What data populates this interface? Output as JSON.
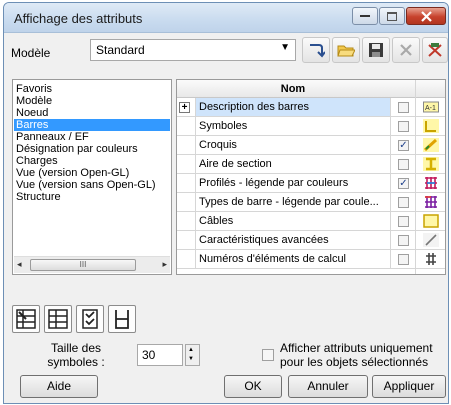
{
  "window": {
    "title": "Affichage des attributs"
  },
  "model": {
    "label": "Modèle",
    "value": "Standard"
  },
  "toolbar": {
    "icons": [
      "arrow-return-icon",
      "folder-open-icon",
      "save-icon",
      "delete-icon",
      "edit-icon"
    ]
  },
  "categories": {
    "items": [
      "Favoris",
      "Modèle",
      "Noeud",
      "Barres",
      "Panneaux / EF",
      "Désignation par couleurs",
      "Charges",
      "Vue (version Open-GL)",
      "Vue (version sans Open-GL)",
      "Structure"
    ],
    "selected": "Barres",
    "scroll_grip": "III"
  },
  "table": {
    "header": "Nom",
    "rows": [
      {
        "name": "Description des barres",
        "checked": false,
        "expandable": true,
        "expander": "+",
        "icon": "bar-description-icon"
      },
      {
        "name": "Symboles",
        "checked": false,
        "expandable": false,
        "icon": "symbols-icon"
      },
      {
        "name": "Croquis",
        "checked": true,
        "expandable": false,
        "icon": "sketch-icon"
      },
      {
        "name": "Aire de section",
        "checked": false,
        "expandable": false,
        "icon": "section-area-icon"
      },
      {
        "name": "Profilés - légende par couleurs",
        "checked": true,
        "expandable": false,
        "icon": "profile-color-legend-icon"
      },
      {
        "name": "Types de barre - légende par coule...",
        "checked": false,
        "expandable": false,
        "icon": "bar-type-legend-icon"
      },
      {
        "name": "Câbles",
        "checked": false,
        "expandable": false,
        "icon": "cables-icon"
      },
      {
        "name": "Caractéristiques avancées",
        "checked": false,
        "expandable": false,
        "icon": "advanced-properties-icon"
      },
      {
        "name": "Numéros d'éléments de calcul",
        "checked": false,
        "expandable": false,
        "icon": "element-numbers-icon"
      }
    ],
    "check_mark": "✓"
  },
  "symbol_size": {
    "label": "Taille des symboles :",
    "value": "30"
  },
  "only_selected": {
    "label": "Afficher attributs uniquement pour les objets sélectionnés",
    "checked": false
  },
  "buttons": {
    "help": "Aide",
    "ok": "OK",
    "cancel": "Annuler",
    "apply": "Appliquer"
  },
  "colors": {
    "selection": "#3399ff",
    "row_highlight": "#cfe4fb",
    "title_bar": "#c9dbef"
  }
}
